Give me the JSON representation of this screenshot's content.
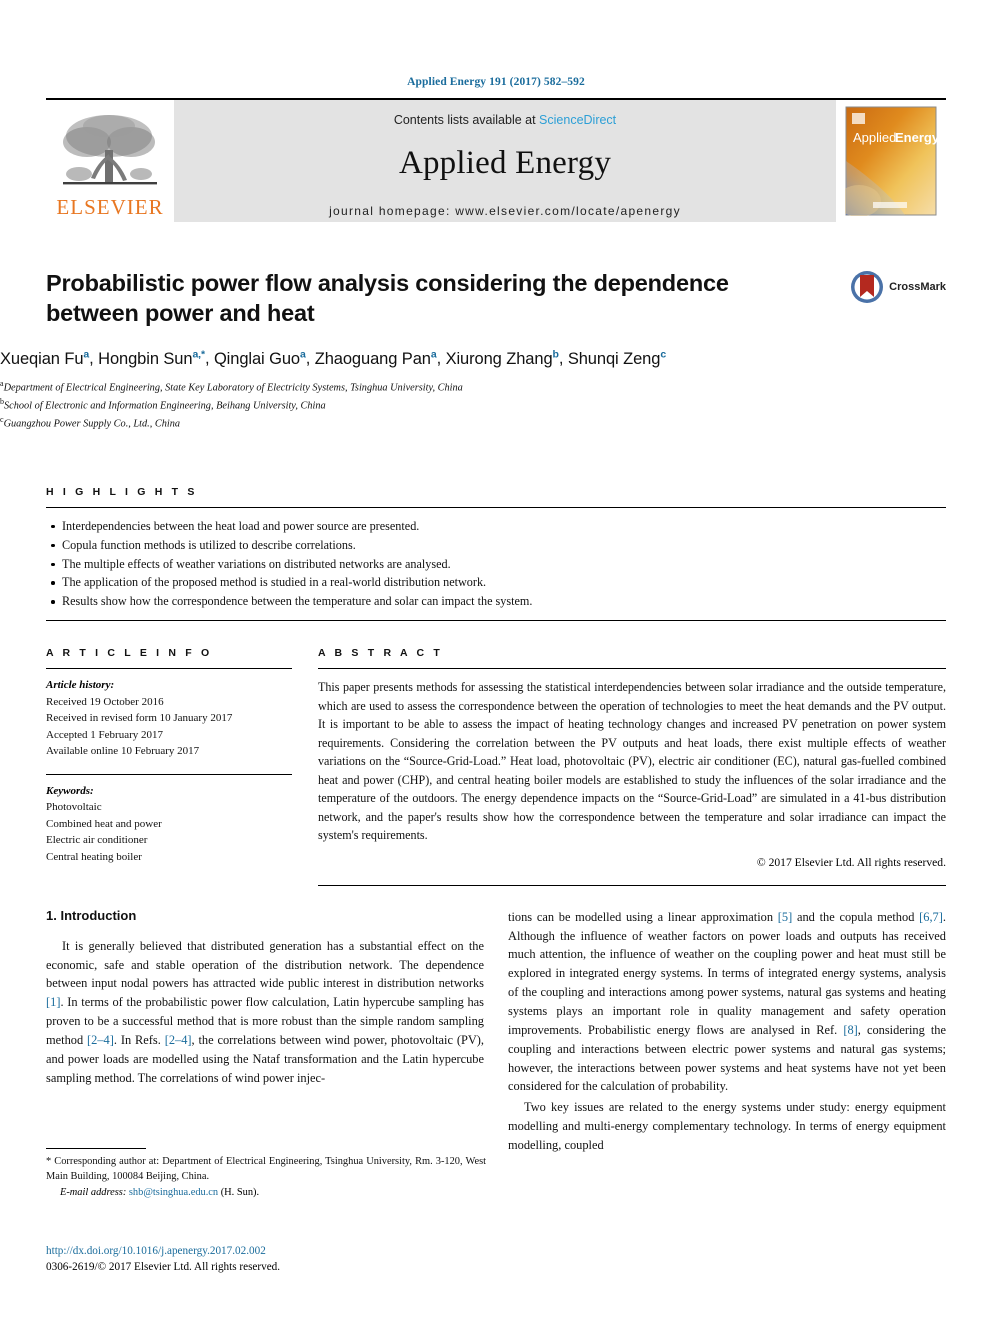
{
  "running_head": "Applied Energy 191 (2017) 582–592",
  "masthead": {
    "publisher": "ELSEVIER",
    "contents_prefix": "Contents lists available at ",
    "contents_link": "ScienceDirect",
    "journal_title": "Applied Energy",
    "homepage": "journal homepage: www.elsevier.com/locate/apenergy",
    "cover_title_a": "Applied",
    "cover_title_b": "Energy"
  },
  "article": {
    "title": "Probabilistic power flow analysis considering the dependence between power and heat",
    "crossmark_label": "CrossMark",
    "authors": [
      {
        "name": "Xueqian Fu",
        "sup": "a",
        "sep": ", "
      },
      {
        "name": "Hongbin Sun",
        "sup": "a,*",
        "sep": ", "
      },
      {
        "name": "Qinglai Guo",
        "sup": "a",
        "sep": ", "
      },
      {
        "name": "Zhaoguang Pan",
        "sup": "a",
        "sep": ", "
      },
      {
        "name": "Xiurong Zhang",
        "sup": "b",
        "sep": ", "
      },
      {
        "name": "Shunqi Zeng",
        "sup": "c",
        "sep": ""
      }
    ],
    "affiliations": [
      {
        "mark": "a",
        "text": "Department of Electrical Engineering, State Key Laboratory of Electricity Systems, Tsinghua University, China"
      },
      {
        "mark": "b",
        "text": "School of Electronic and Information Engineering, Beihang University, China"
      },
      {
        "mark": "c",
        "text": "Guangzhou Power Supply Co., Ltd., China"
      }
    ]
  },
  "highlights": {
    "heading": "H I G H L I G H T S",
    "items": [
      "Interdependencies between the heat load and power source are presented.",
      "Copula function methods is utilized to describe correlations.",
      "The multiple effects of weather variations on distributed networks are analysed.",
      "The application of the proposed method is studied in a real-world distribution network.",
      "Results show how the correspondence between the temperature and solar can impact the system."
    ]
  },
  "article_info": {
    "heading": "A R T I C L E   I N F O",
    "history_label": "Article history:",
    "history": [
      "Received 19 October 2016",
      "Received in revised form 10 January 2017",
      "Accepted 1 February 2017",
      "Available online 10 February 2017"
    ],
    "keywords_label": "Keywords:",
    "keywords": [
      "Photovoltaic",
      "Combined heat and power",
      "Electric air conditioner",
      "Central heating boiler"
    ]
  },
  "abstract": {
    "heading": "A B S T R A C T",
    "text": "This paper presents methods for assessing the statistical interdependencies between solar irradiance and the outside temperature, which are used to assess the correspondence between the operation of technologies to meet the heat demands and the PV output. It is important to be able to assess the impact of heating technology changes and increased PV penetration on power system requirements. Considering the correlation between the PV outputs and heat loads, there exist multiple effects of weather variations on the “Source-Grid-Load.” Heat load, photovoltaic (PV), electric air conditioner (EC), natural gas-fuelled combined heat and power (CHP), and central heating boiler models are established to study the influences of the solar irradiance and the temperature of the outdoors. The energy dependence impacts on the “Source-Grid-Load” are simulated in a 41-bus distribution network, and the paper's results show how the correspondence between the temperature and solar irradiance can impact the system's requirements.",
    "copyright": "© 2017 Elsevier Ltd. All rights reserved."
  },
  "introduction": {
    "heading": "1. Introduction",
    "left_paragraph_1": "It is generally believed that distributed generation has a substantial effect on the economic, safe and stable operation of the distribution network. The dependence between input nodal powers has attracted wide public interest in distribution networks [1]. In terms of the probabilistic power flow calculation, Latin hypercube sampling has proven to be a successful method that is more robust than the simple random sampling method [2–4]. In Refs. [2–4], the correlations between wind power, photovoltaic (PV), and power loads are modelled using the Nataf transformation and the Latin hypercube sampling method. The correlations of wind power injec-",
    "right_paragraph_1": "tions can be modelled using a linear approximation [5] and the copula method [6,7]. Although the influence of weather factors on power loads and outputs has received much attention, the influence of weather on the coupling power and heat must still be explored in integrated energy systems. In terms of integrated energy systems, analysis of the coupling and interactions among power systems, natural gas systems and heating systems plays an important role in quality management and safety operation improvements. Probabilistic energy flows are analysed in Ref. [8], considering the coupling and interactions between electric power systems and natural gas systems; however, the interactions between power systems and heat systems have not yet been considered for the calculation of probability.",
    "right_paragraph_2": "Two key issues are related to the energy systems under study: energy equipment modelling and multi-energy complementary technology. In terms of energy equipment modelling, coupled"
  },
  "footnote": {
    "corresponding": "* Corresponding author at: Department of Electrical Engineering, Tsinghua University, Rm. 3-120, West Main Building, 100084 Beijing, China.",
    "email_label": "E-mail address:",
    "email": "shb@tsinghua.edu.cn",
    "email_suffix": " (H. Sun)."
  },
  "footer": {
    "doi": "http://dx.doi.org/10.1016/j.apenergy.2017.02.002",
    "issn_line": "0306-2619/© 2017 Elsevier Ltd. All rights reserved."
  },
  "colors": {
    "link_blue": "#1a6c9c",
    "sciencedirect_blue": "#2c9fd6",
    "elsevier_orange": "#e87722"
  }
}
